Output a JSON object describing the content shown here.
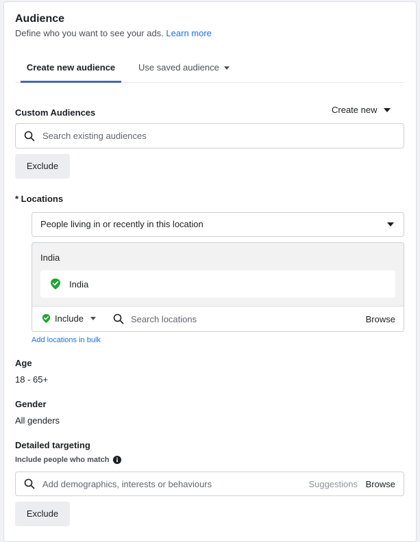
{
  "header": {
    "title": "Audience",
    "subtitle": "Define who you want to see your ads.",
    "learn_more": "Learn more"
  },
  "tabs": {
    "active": "Create new audience",
    "saved": "Use saved audience"
  },
  "custom_audiences": {
    "label": "Custom Audiences",
    "create_new": "Create new",
    "search_placeholder": "Search existing audiences",
    "exclude": "Exclude"
  },
  "locations": {
    "label": "* Locations",
    "type_select": "People living in or recently in this location",
    "group_name": "India",
    "selected": "India",
    "include": "Include",
    "search_placeholder": "Search locations",
    "browse": "Browse",
    "bulk_link": "Add locations in bulk"
  },
  "age": {
    "label": "Age",
    "value": "18 - 65+"
  },
  "gender": {
    "label": "Gender",
    "value": "All genders"
  },
  "detailed_targeting": {
    "label": "Detailed targeting",
    "sublabel": "Include people who match",
    "search_placeholder": "Add demographics, interests or behaviours",
    "suggestions": "Suggestions",
    "browse": "Browse",
    "exclude": "Exclude"
  },
  "colors": {
    "accent": "#4267b2",
    "link": "#216fdb",
    "pin": "#1ea630"
  }
}
